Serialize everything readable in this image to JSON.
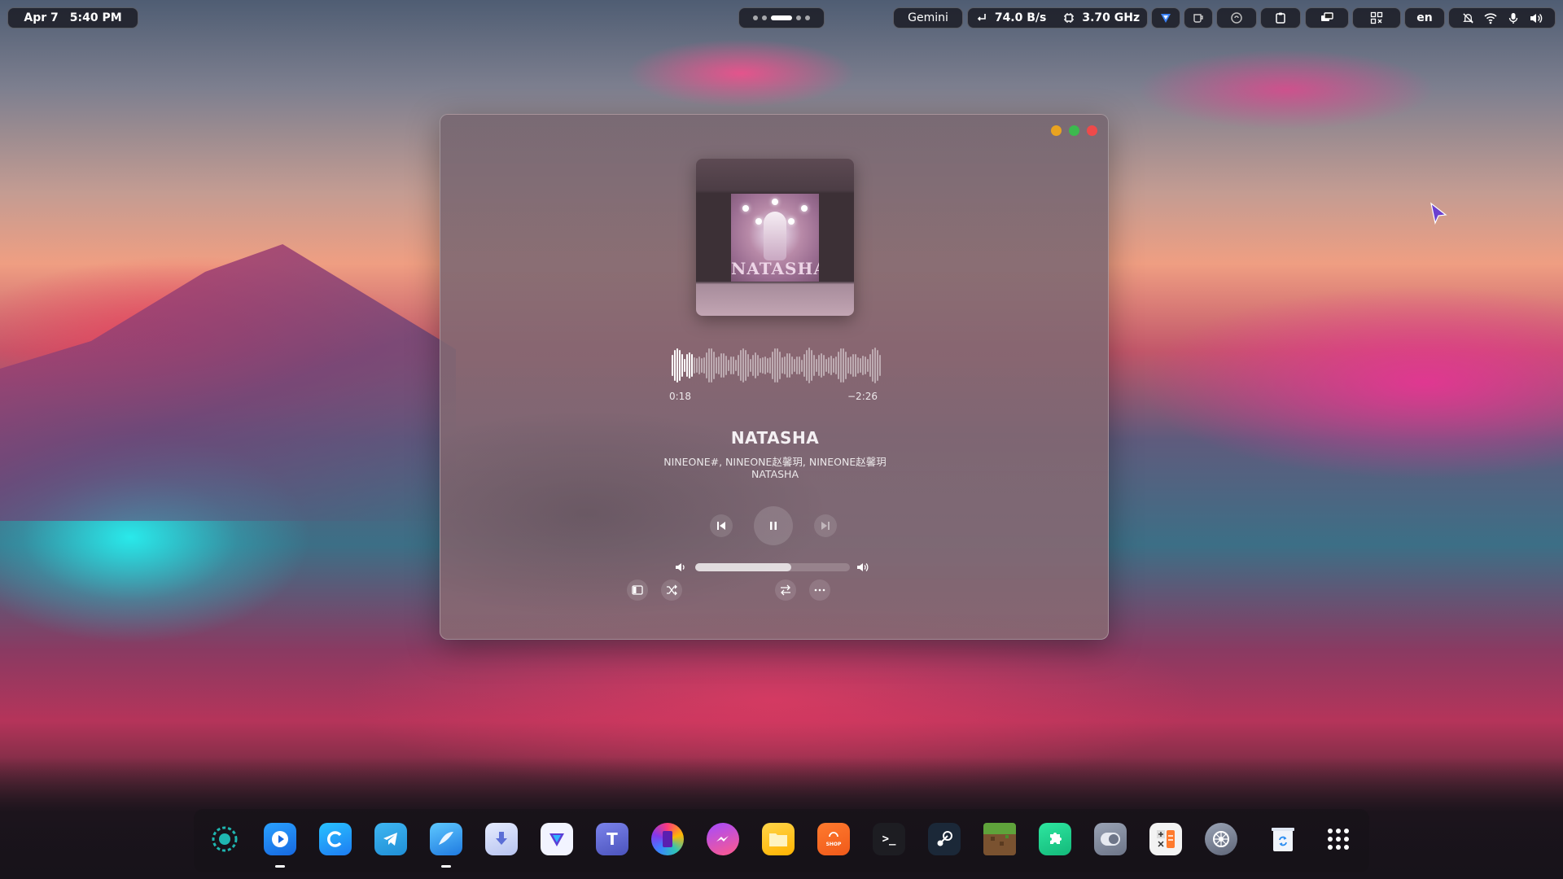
{
  "topbar": {
    "date": "Apr 7",
    "time": "5:40 PM",
    "assistant_label": "Gemini",
    "network_speed": "74.0 B/s",
    "cpu_freq": "3.70 GHz",
    "language": "en",
    "workspace_count": 5,
    "active_workspace": 3,
    "tray_icons": [
      "vpn-icon",
      "mug-icon",
      "sync-icon",
      "clipboard-icon",
      "display-icon",
      "screenshot-icon"
    ],
    "status_icons": [
      "notifications-muted-icon",
      "wifi-icon",
      "microphone-icon",
      "volume-icon"
    ]
  },
  "player": {
    "album_art_text": "NATASHA",
    "elapsed": "0:18",
    "remaining": "−2:26",
    "progress": 0.11,
    "song_title": "NATASHA",
    "artists": "NINEONE#, NINEONE赵馨玥, NINEONE赵馨玥",
    "album": "NATASHA",
    "volume": 0.62,
    "colors": {
      "close": "#ee4a4a",
      "minimize": "#e9a320",
      "maximize": "#3cb94e"
    }
  },
  "dock": {
    "apps": [
      {
        "name": "launcher-icon",
        "running": false
      },
      {
        "name": "video-player-icon",
        "running": true
      },
      {
        "name": "browser-c-icon",
        "running": false
      },
      {
        "name": "telegram-icon",
        "running": false
      },
      {
        "name": "music-player-icon",
        "running": true
      },
      {
        "name": "downloader-icon",
        "running": false
      },
      {
        "name": "vpn-app-icon",
        "running": false
      },
      {
        "name": "teams-icon",
        "running": false
      },
      {
        "name": "phone-link-icon",
        "running": false
      },
      {
        "name": "messenger-icon",
        "running": false
      },
      {
        "name": "files-icon",
        "running": false
      },
      {
        "name": "shop-icon",
        "running": false
      },
      {
        "name": "terminal-icon",
        "running": false
      },
      {
        "name": "steam-icon",
        "running": false
      },
      {
        "name": "minecraft-icon",
        "running": false
      },
      {
        "name": "extensions-icon",
        "running": false
      },
      {
        "name": "toggle-app-icon",
        "running": false
      },
      {
        "name": "calculator-icon",
        "running": false
      },
      {
        "name": "settings-icon",
        "running": false
      },
      {
        "name": "trash-icon",
        "running": false
      },
      {
        "name": "app-grid-icon",
        "running": false
      }
    ],
    "shop_label": "SHOP",
    "terminal_glyph": ">_"
  }
}
